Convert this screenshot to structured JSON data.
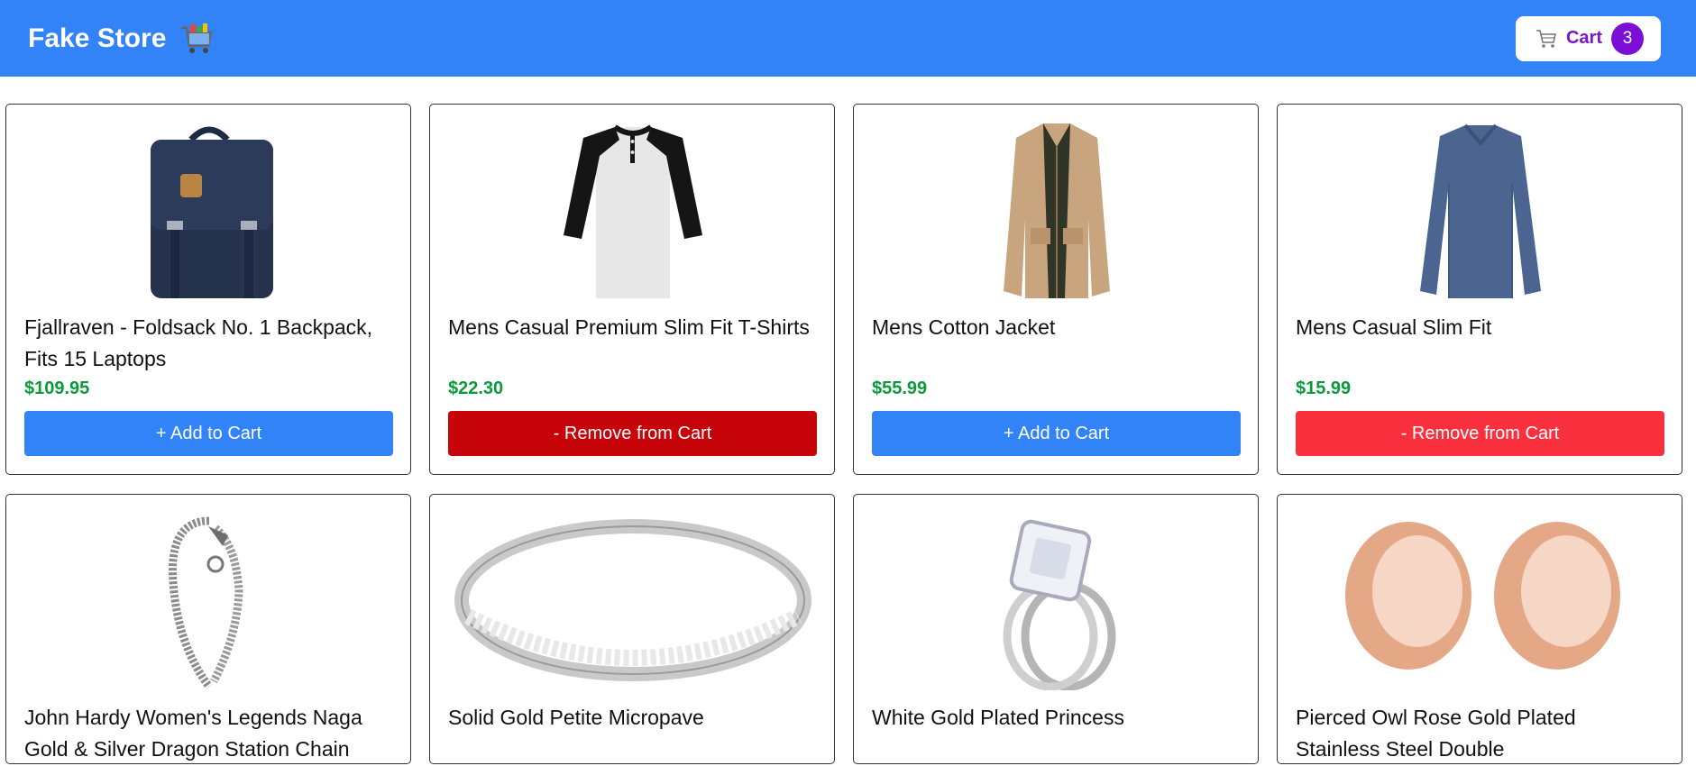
{
  "navbar": {
    "brand": "Fake Store",
    "brand_icon": "shopping-cart-emoji-icon",
    "cart": {
      "label": "Cart",
      "count": "3",
      "icon": "cart-icon"
    }
  },
  "colors": {
    "navbar": "#3282f8",
    "add_button": "#3282f8",
    "remove_button": "#fa303f",
    "remove_button_active": "#c70409",
    "price": "#0b9a3b",
    "cart_badge": "#7c0fd6"
  },
  "products": [
    {
      "title": "Fjallraven - Foldsack No. 1 Backpack, Fits 15 Laptops",
      "price": "$109.95",
      "button": "+ Add to Cart",
      "in_cart": false,
      "image": "navy-backpack-image"
    },
    {
      "title": "Mens Casual Premium Slim Fit T-Shirts",
      "price": "$22.30",
      "button": "- Remove from Cart",
      "in_cart": true,
      "image": "raglan-tshirt-image"
    },
    {
      "title": "Mens Cotton Jacket",
      "price": "$55.99",
      "button": "+ Add to Cart",
      "in_cart": false,
      "image": "khaki-jacket-image"
    },
    {
      "title": "Mens Casual Slim Fit",
      "price": "$15.99",
      "button": "- Remove from Cart",
      "in_cart": true,
      "image": "blue-longsleeve-image"
    },
    {
      "title": "John Hardy Women's Legends Naga Gold & Silver Dragon Station Chain",
      "image": "dragon-bracelet-image"
    },
    {
      "title": "Solid Gold Petite Micropave",
      "image": "micropave-ring-image"
    },
    {
      "title": "White Gold Plated Princess",
      "image": "princess-ring-image"
    },
    {
      "title": "Pierced Owl Rose Gold Plated Stainless Steel Double",
      "image": "rose-gold-plugs-image"
    }
  ]
}
